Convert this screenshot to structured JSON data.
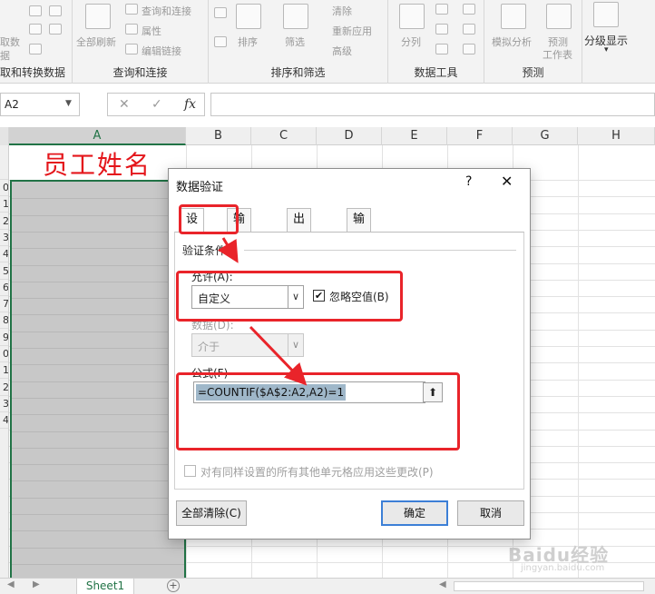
{
  "ribbon": {
    "groups": [
      {
        "label": "取和转换数据",
        "items": [
          "取数",
          "据"
        ]
      },
      {
        "label": "查询和连接",
        "items": [
          "全部刷新",
          "查询和连接",
          "属性",
          "编辑链接"
        ]
      },
      {
        "label": "排序和筛选",
        "items": [
          "排序",
          "筛选",
          "清除",
          "重新应用",
          "高级"
        ]
      },
      {
        "label": "数据工具",
        "items": [
          "分列"
        ]
      },
      {
        "label": "预测",
        "items": [
          "模拟分析",
          "预测",
          "工作表"
        ]
      },
      {
        "label": "",
        "items": [
          "分级显示"
        ]
      }
    ]
  },
  "formula_bar": {
    "name_box": "A2",
    "cancel": "✕",
    "enter": "✓",
    "fx": "fx",
    "formula": ""
  },
  "grid": {
    "columns": [
      "A",
      "B",
      "C",
      "D",
      "E",
      "F",
      "G",
      "H"
    ],
    "rows": [
      "",
      "0",
      "1",
      "2",
      "3",
      "4",
      "5",
      "6",
      "7",
      "8",
      "9",
      "0",
      "1",
      "2",
      "3",
      "4"
    ],
    "a1_text": "员工姓名"
  },
  "sheets": {
    "tab": "Sheet1",
    "add": "+"
  },
  "dialog": {
    "title": "数据验证",
    "help": "?",
    "close": "✕",
    "tabs": [
      "设置",
      "输入信息",
      "出错警告",
      "输入法模式"
    ],
    "section_label": "验证条件",
    "allow_label": "允许(A):",
    "allow_value": "自定义",
    "ignore_blank_label": "忽略空值(B)",
    "ignore_blank_checked": "✔",
    "data_label": "数据(D):",
    "data_value": "介于",
    "formula_label": "公式(F)",
    "formula_value": "=COUNTIF($A$2:A2,A2)=1",
    "formula_ref_icon": "⬆",
    "apply_all_label": "对有同样设置的所有其他单元格应用这些更改(P)",
    "clear_all": "全部清除(C)",
    "ok": "确定",
    "cancel": "取消"
  },
  "annotation_color": "#e9242a",
  "accent_color": "#217346",
  "watermark": {
    "text": "Baidu经验",
    "sub": "jingyan.baidu.com"
  }
}
